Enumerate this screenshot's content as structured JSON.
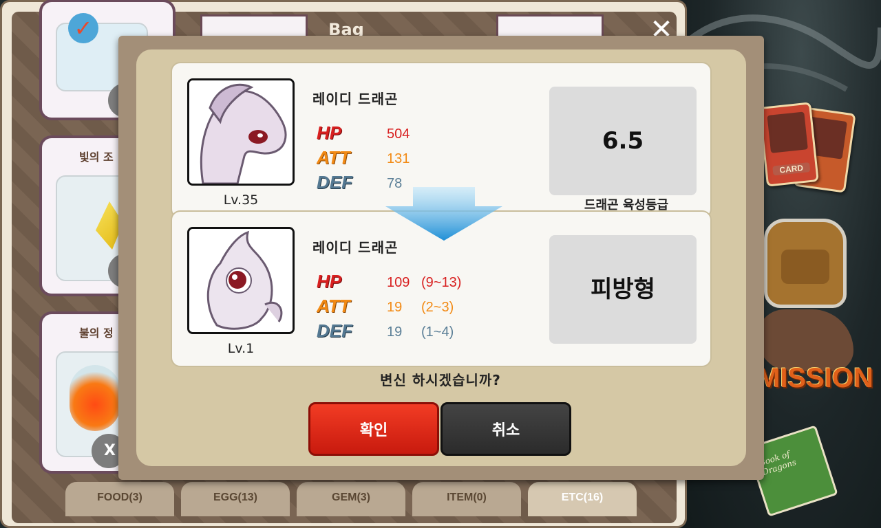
{
  "bag": {
    "title": "Bag",
    "close_label": "✕",
    "items": [
      {
        "label": ""
      },
      {
        "label": "빛의 조"
      },
      {
        "label": "불의 정"
      }
    ],
    "remove_label": "X"
  },
  "tabs": [
    {
      "label": "FOOD(3)"
    },
    {
      "label": "EGG(13)"
    },
    {
      "label": "GEM(3)"
    },
    {
      "label": "ITEM(0)"
    },
    {
      "label": "ETC(16)"
    }
  ],
  "dialog": {
    "current": {
      "name": "레이디 드래곤",
      "level": "Lv.35",
      "hp_label": "HP",
      "hp": "504",
      "att_label": "ATT",
      "att": "131",
      "def_label": "DEF",
      "def": "78",
      "grade": "6.5",
      "grade_caption": "드래곤 육성등급"
    },
    "result": {
      "name": "레이디 드래곤",
      "level": "Lv.1",
      "hp_label": "HP",
      "hp": "109",
      "hp_range": "(9~13)",
      "att_label": "ATT",
      "att": "19",
      "att_range": "(2~3)",
      "def_label": "DEF",
      "def": "19",
      "def_range": "(1~4)",
      "type": "피방형"
    },
    "question": "변신 하시겠습니까?",
    "confirm_label": "확인",
    "cancel_label": "취소"
  },
  "side": {
    "card_label": "CARD",
    "mission_label": "MISSION",
    "book_label": "Book of Dragons"
  }
}
